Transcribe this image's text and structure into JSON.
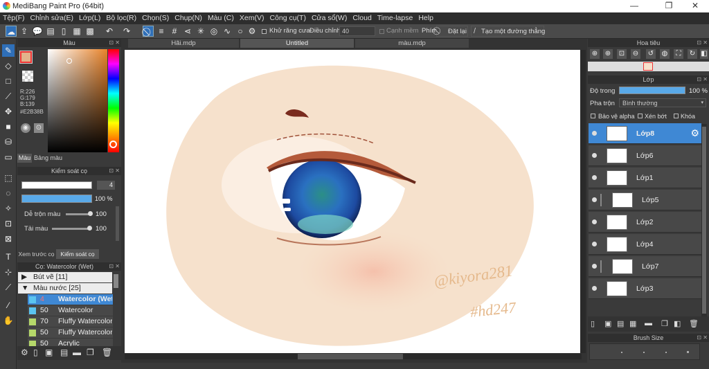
{
  "app": {
    "title": "MediBang Paint Pro (64bit)",
    "min": "—",
    "restore": "❐",
    "close": "✕"
  },
  "menu": [
    "Tệp(F)",
    "Chỉnh sửa(E)",
    "Lớp(L)",
    "Bộ lọc(R)",
    "Chọn(S)",
    "Chụp(N)",
    "Màu (C)",
    "Xem(V)",
    "Công cụ(T)",
    "Cửa sổ(W)",
    "Cloud",
    "Time-lapse",
    "Help"
  ],
  "toolbar": {
    "antialias": "Khử răng cưa",
    "adjust": "Điều chỉnh",
    "adjust_value": "40",
    "edge": "Cạnh mềm",
    "key_label": "Phím",
    "reset": "Đặt lại",
    "create_line": "Tạo một đường thẳng"
  },
  "color_panel": {
    "title": "Màu",
    "r": "R:226",
    "g": "G:179",
    "b": "B:139",
    "hex": "#E2B38B",
    "tab_color": "Màu",
    "tab_palette": "Bảng màu"
  },
  "brush_control": {
    "title": "Kiểm soát cọ",
    "size": "4",
    "opacity": "100 %",
    "mix_label": "Dễ trộn màu",
    "mix_value": "100",
    "load_label": "Tải màu",
    "load_value": "100",
    "tab_preview": "Xem trước cọ",
    "tab_control": "Kiểm soát cọ"
  },
  "brush_list": {
    "title": "Cọ: Watercolor (Wet)",
    "groups": [
      {
        "label": "Bút vẽ [11]",
        "arrow": "▶"
      },
      {
        "label": "Màu nước [25]",
        "arrow": "▼"
      }
    ],
    "items": [
      {
        "num": "4",
        "name": "Watercolor (Wet)",
        "color": "#5bc4f0",
        "selected": true
      },
      {
        "num": "50",
        "name": "Watercolor",
        "color": "#5bc4f0",
        "selected": false
      },
      {
        "num": "70",
        "name": "Fluffy Watercolor",
        "color": "#b5d86a",
        "selected": false
      },
      {
        "num": "50",
        "name": "Fluffy Watercolor",
        "color": "#b5d86a",
        "selected": false
      },
      {
        "num": "50",
        "name": "Acrylic",
        "color": "#b5d86a",
        "selected": false
      }
    ]
  },
  "tabs": [
    {
      "label": "Hãi.mdp",
      "active": false
    },
    {
      "label": "Untitled",
      "active": true
    },
    {
      "label": "màu.mdp",
      "active": false
    }
  ],
  "canvas": {
    "signature1": "@kiyora281",
    "signature2": "#hd247"
  },
  "navigator": {
    "title": "Hoa tiêu"
  },
  "layer_panel": {
    "title": "Lớp",
    "opacity_label": "Độ trong",
    "opacity_value": "100 %",
    "blend_label": "Pha trộn",
    "blend_value": "Bình thường",
    "protect_alpha": "Bảo vệ alpha",
    "clip": "Xén bớt",
    "lock": "Khóa",
    "layers": [
      {
        "name": "Lớp8",
        "selected": true,
        "indent": false
      },
      {
        "name": "Lớp6",
        "selected": false,
        "indent": false
      },
      {
        "name": "Lớp1",
        "selected": false,
        "indent": false
      },
      {
        "name": "Lớp5",
        "selected": false,
        "indent": true
      },
      {
        "name": "Lớp2",
        "selected": false,
        "indent": false
      },
      {
        "name": "Lớp4",
        "selected": false,
        "indent": false
      },
      {
        "name": "Lớp7",
        "selected": false,
        "indent": true
      },
      {
        "name": "Lớp3",
        "selected": false,
        "indent": false
      }
    ]
  },
  "brush_size": {
    "title": "Brush Size"
  }
}
